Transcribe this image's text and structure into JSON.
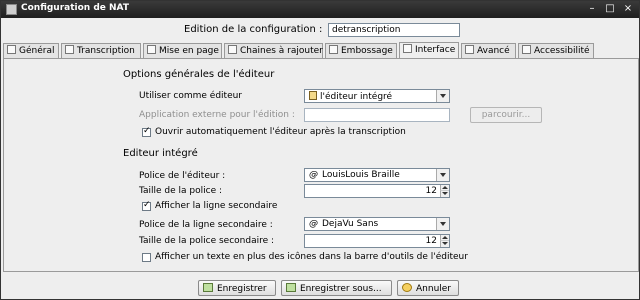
{
  "window": {
    "title": "Configuration de NAT"
  },
  "config": {
    "label": "Edition de la configuration :",
    "value": "detranscription"
  },
  "tabs": [
    {
      "label": "Général"
    },
    {
      "label": "Transcription"
    },
    {
      "label": "Mise en page"
    },
    {
      "label": "Chaines à rajouter"
    },
    {
      "label": "Embossage"
    },
    {
      "label": "Interface",
      "active": true
    },
    {
      "label": "Avancé"
    },
    {
      "label": "Accessibilité"
    }
  ],
  "editor_options": {
    "section_title": "Options générales de l'éditeur",
    "use_editor_label": "Utiliser comme éditeur",
    "use_editor_value": "l'éditeur intégré",
    "external_app_label": "Application externe pour l'édition :",
    "external_app_value": "",
    "browse_label": "parcourir...",
    "auto_open_label": "Ouvrir automatiquement l'éditeur après la transcription",
    "auto_open_checked": true
  },
  "integrated_editor": {
    "section_title": "Editeur intégré",
    "font_label": "Police de l'éditeur :",
    "font_value": "LouisLouis Braille",
    "font_size_label": "Taille de la police :",
    "font_size_value": "12",
    "show_secondary_label": "Afficher la ligne secondaire",
    "show_secondary_checked": true,
    "secondary_font_label": "Police de la ligne secondaire :",
    "secondary_font_value": "DejaVu Sans",
    "secondary_size_label": "Taille de la police secondaire :",
    "secondary_size_value": "12",
    "toolbar_text_label": "Afficher un texte en plus des icônes dans la barre d'outils de l'éditeur",
    "toolbar_text_checked": false
  },
  "footer": {
    "save_label": "Enregistrer",
    "save_as_label": "Enregistrer sous...",
    "cancel_label": "Annuler"
  }
}
